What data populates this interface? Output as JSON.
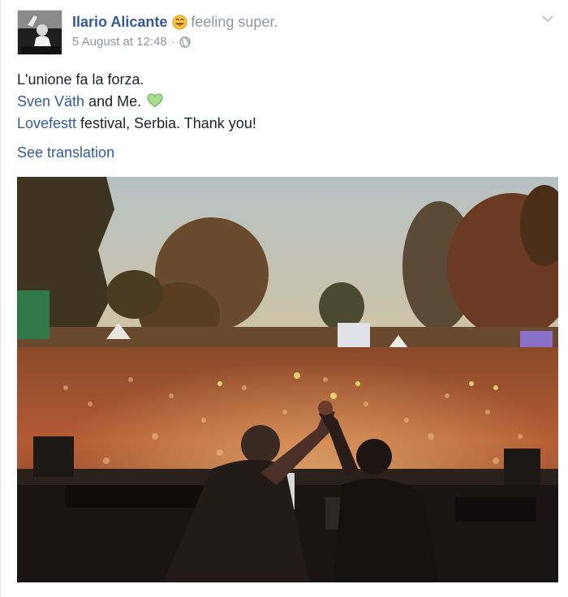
{
  "post": {
    "author": "Ilario Alicante",
    "feeling": "feeling super.",
    "feeling_emoji": "tongue-out-emoji",
    "date": "5 August at 12:48",
    "separator": "·",
    "privacy_icon": "globe-icon",
    "menu_icon": "chevron-down-icon",
    "message": {
      "line1": "L'unione fa la forza.",
      "mention1": "Sven Väth",
      "line2_rest": " and Me. ",
      "heart_icon": "green-heart-icon",
      "mention2": "Lovefestt",
      "line3_rest": " festival, Serbia. Thank you!"
    },
    "see_translation": "See translation",
    "photo_icon": "festival-photo"
  },
  "colors": {
    "link": "#365899",
    "text": "#1d2129",
    "muted": "#90949c",
    "heart": "#8ccf7e"
  }
}
